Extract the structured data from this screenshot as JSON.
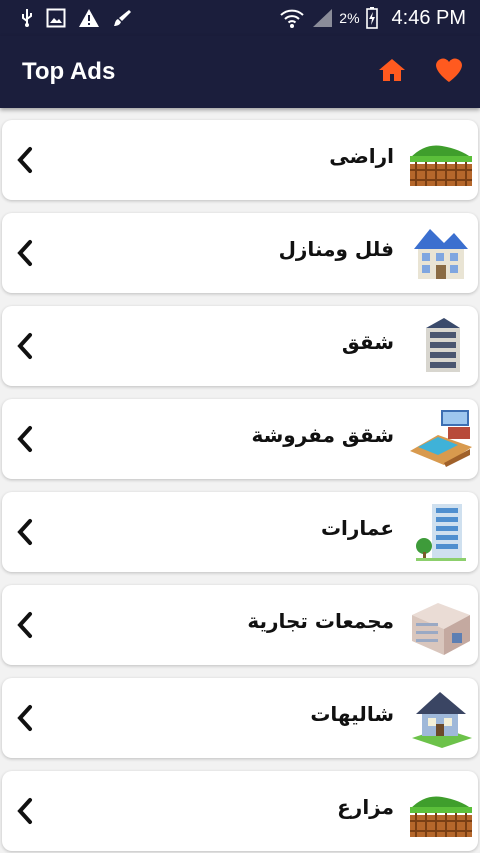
{
  "status_bar": {
    "battery_percent": "2%",
    "time": "4:46 PM",
    "icons": [
      "usb-icon",
      "image-icon",
      "warning-icon",
      "brush-icon",
      "wifi-icon",
      "signal-icon",
      "battery-icon"
    ]
  },
  "app_bar": {
    "title": "Top Ads",
    "actions": [
      "home-icon",
      "heart-icon"
    ],
    "accent_color": "#ff5a1f",
    "background_color": "#1b1e3c"
  },
  "categories": [
    {
      "label": "اراضى",
      "icon": "land-icon"
    },
    {
      "label": "فلل ومنازل",
      "icon": "villa-icon"
    },
    {
      "label": "شقق",
      "icon": "apartment-icon"
    },
    {
      "label": "شقق مفروشة",
      "icon": "furnished-apartment-icon"
    },
    {
      "label": "عمارات",
      "icon": "building-icon"
    },
    {
      "label": "مجمعات تجارية",
      "icon": "mall-icon"
    },
    {
      "label": "شاليهات",
      "icon": "chalet-icon"
    },
    {
      "label": "مزارع",
      "icon": "farm-icon"
    }
  ]
}
